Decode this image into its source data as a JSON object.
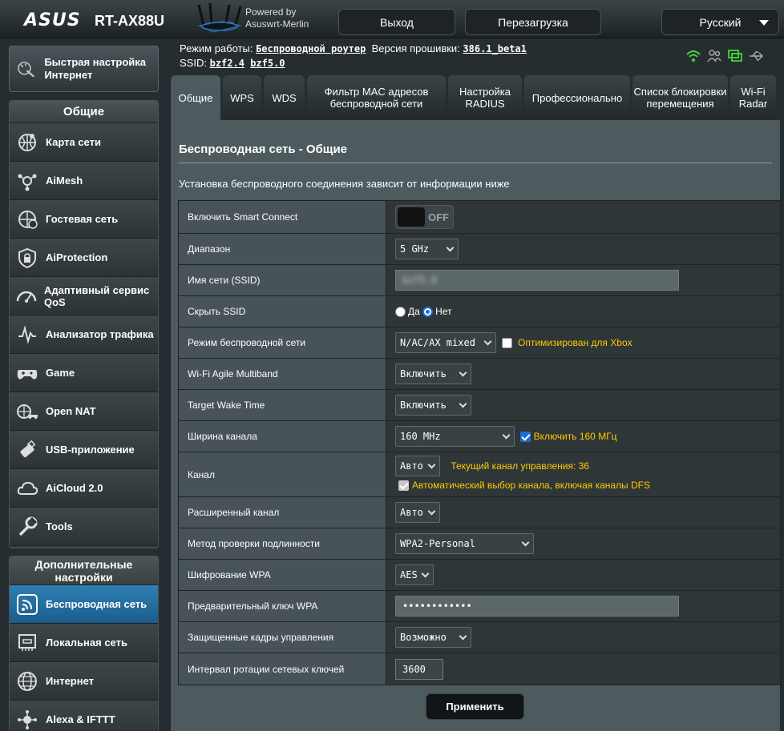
{
  "header": {
    "brand": "ASUS",
    "model": "RT-AX88U",
    "powered_line1": "Powered by",
    "powered_line2": "Asuswrt-Merlin",
    "logout": "Выход",
    "reboot": "Перезагрузка",
    "language": "Русский"
  },
  "info": {
    "mode_label": "Режим работы:",
    "mode_value": "Беспроводной роутер",
    "fw_label": "Версия прошивки:",
    "fw_value": "386.1_beta1",
    "ssid_label": "SSID:",
    "ssid1": "bzf2.4",
    "ssid2": "bzf5.0"
  },
  "sidebar": {
    "quick_setup": "Быстрая настройка Интернет",
    "general_title": "Общие",
    "general_items": [
      {
        "label": "Карта сети",
        "icon": "network-map-icon"
      },
      {
        "label": "AiMesh",
        "icon": "aimesh-icon"
      },
      {
        "label": "Гостевая сеть",
        "icon": "guest-network-icon"
      },
      {
        "label": "AiProtection",
        "icon": "aiprotection-icon"
      },
      {
        "label": "Адаптивный сервис QoS",
        "icon": "qos-icon"
      },
      {
        "label": "Анализатор трафика",
        "icon": "traffic-analyzer-icon"
      },
      {
        "label": "Game",
        "icon": "game-icon"
      },
      {
        "label": "Open NAT",
        "icon": "open-nat-icon"
      },
      {
        "label": "USB-приложение",
        "icon": "usb-icon"
      },
      {
        "label": "AiCloud 2.0",
        "icon": "aicloud-icon"
      },
      {
        "label": "Tools",
        "icon": "tools-icon"
      }
    ],
    "advanced_title": "Дополнительные настройки",
    "advanced_items": [
      {
        "label": "Беспроводная сеть",
        "icon": "wireless-icon"
      },
      {
        "label": "Локальная сеть",
        "icon": "lan-icon"
      },
      {
        "label": "Интернет",
        "icon": "internet-icon"
      },
      {
        "label": "Alexa & IFTTT",
        "icon": "alexa-icon"
      }
    ]
  },
  "tabs": [
    "Общие",
    "WPS",
    "WDS",
    "Фильтр MAC адресов беспроводной сети",
    "Настройка RADIUS",
    "Профессионально",
    "Список блокировки перемещения",
    "Wi-Fi Radar"
  ],
  "panel": {
    "title": "Беспроводная сеть - Общие",
    "description": "Установка беспроводного соединения зависит от информации ниже",
    "apply": "Применить"
  },
  "settings": {
    "smart_connect": {
      "label": "Включить Smart Connect",
      "state": "OFF"
    },
    "band": {
      "label": "Диапазон",
      "value": "5 GHz"
    },
    "ssid": {
      "label": "Имя сети (SSID)",
      "value": "bzf5.0"
    },
    "hide_ssid": {
      "label": "Скрыть SSID",
      "opt_yes": "Да",
      "opt_no": "Нет"
    },
    "wireless_mode": {
      "label": "Режим беспроводной сети",
      "value": "N/AC/AX mixed",
      "xbox": "Оптимизирован для Xbox"
    },
    "agile": {
      "label": "Wi-Fi Agile Multiband",
      "value": "Включить"
    },
    "twt": {
      "label": "Target Wake Time",
      "value": "Включить"
    },
    "bandwidth": {
      "label": "Ширина канала",
      "value": "160 MHz",
      "check": "Включить 160 МГц"
    },
    "channel": {
      "label": "Канал",
      "value": "Авто",
      "current": "Текущий канал управления: 36",
      "dfs": "Автоматический выбор канала, включая каналы DFS"
    },
    "ext_channel": {
      "label": "Расширенный канал",
      "value": "Авто"
    },
    "auth": {
      "label": "Метод проверки подлинности",
      "value": "WPA2-Personal"
    },
    "wpa_enc": {
      "label": "Шифрование WPA",
      "value": "AES"
    },
    "wpa_key": {
      "label": "Предварительный ключ WPA",
      "value": "••••••••••••"
    },
    "pmf": {
      "label": "Защищенные кадры управления",
      "value": "Возможно"
    },
    "rotation": {
      "label": "Интервал ротации сетевых ключей",
      "value": "3600"
    }
  }
}
